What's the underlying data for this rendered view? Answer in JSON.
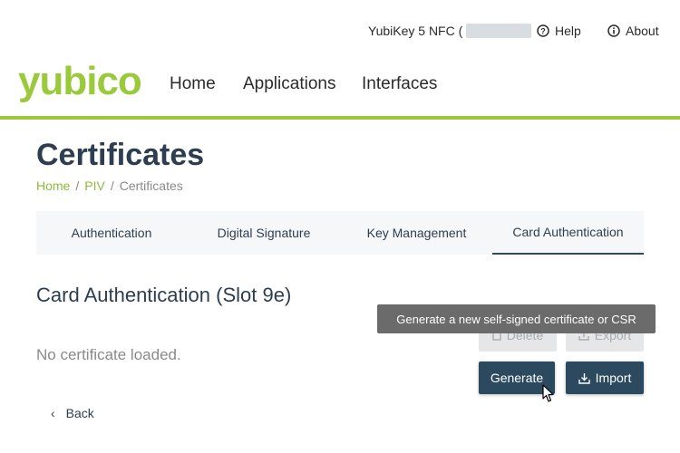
{
  "header": {
    "device": "YubiKey 5 NFC (",
    "help_label": "Help",
    "about_label": "About",
    "logo": "yubico",
    "nav": [
      "Home",
      "Applications",
      "Interfaces"
    ],
    "accent_color": "#9aca3c"
  },
  "page": {
    "title": "Certificates",
    "breadcrumb": [
      {
        "label": "Home"
      },
      {
        "label": "PIV"
      },
      {
        "label": "Certificates"
      }
    ]
  },
  "tabs": [
    {
      "label": "Authentication",
      "active": false
    },
    {
      "label": "Digital Signature",
      "active": false
    },
    {
      "label": "Key Management",
      "active": false
    },
    {
      "label": "Card Authentication",
      "active": true
    }
  ],
  "slot": {
    "title": "Card Authentication (Slot 9e)",
    "status": "No certificate loaded."
  },
  "buttons": {
    "delete": "Delete",
    "export": "Export",
    "generate": "Generate",
    "import": "Import"
  },
  "tooltip": "Generate a new self-signed certificate or CSR",
  "back_label": "Back"
}
